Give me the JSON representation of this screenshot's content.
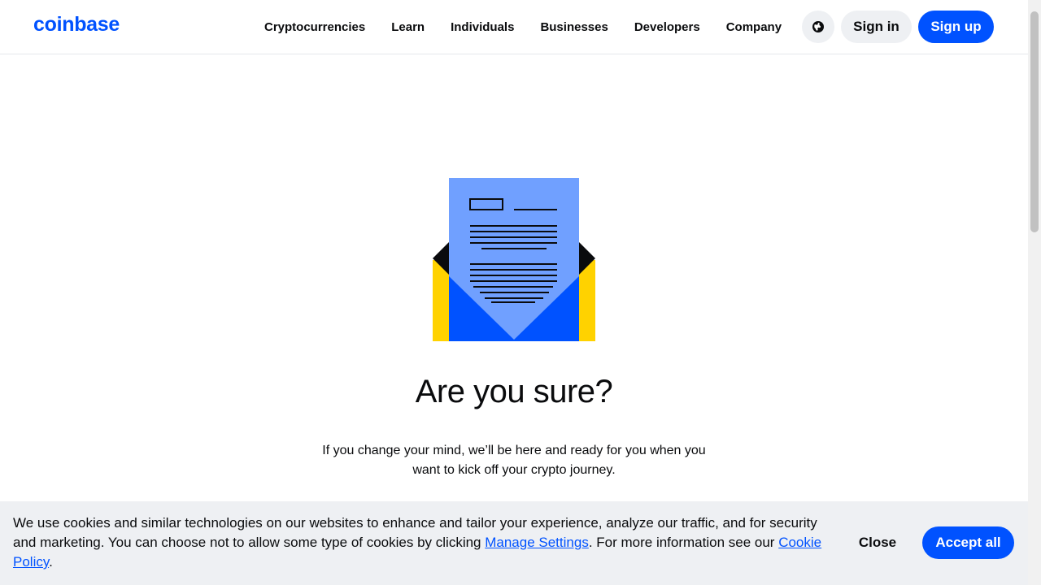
{
  "header": {
    "logo": "coinbase",
    "nav": [
      "Cryptocurrencies",
      "Learn",
      "Individuals",
      "Businesses",
      "Developers",
      "Company"
    ],
    "globe_icon": "globe-icon",
    "sign_in": "Sign in",
    "sign_up": "Sign up"
  },
  "main": {
    "illustration_icon": "envelope-letter-icon",
    "headline": "Are you sure?",
    "subtext": "If you change your mind, we’ll be here and ready for you when you want to kick off your crypto journey."
  },
  "cookie_banner": {
    "text_before": "We use cookies and similar technologies on our websites to enhance and tailor your experience, analyze our traffic, and for security and marketing. You can choose not to allow some type of cookies by clicking ",
    "manage_link": "Manage Settings",
    "text_middle": ". For more information see our ",
    "policy_link": "Cookie Policy",
    "text_after": ".",
    "close": "Close",
    "accept": "Accept all"
  },
  "colors": {
    "brand_blue": "#0052ff",
    "light_blue": "#70a0ff",
    "yellow": "#ffd200",
    "banner_bg": "#eef0f3"
  }
}
